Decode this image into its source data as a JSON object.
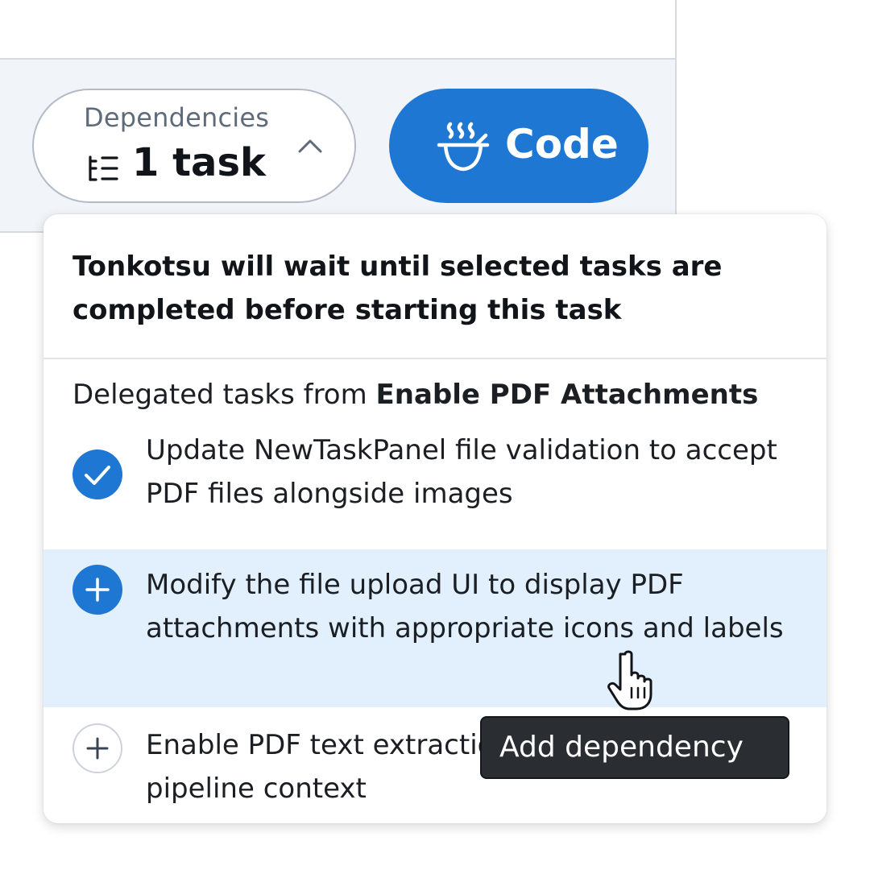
{
  "toolbar": {
    "dependencies": {
      "label": "Dependencies",
      "count": "1 task",
      "list_icon": "list-tree-icon",
      "chevron_icon": "chevron-up-icon"
    },
    "code_button": {
      "label": "Code",
      "icon": "ramen-bowl-icon",
      "color": "#1f77d4"
    }
  },
  "dropdown": {
    "header": "Tonkotsu will wait until selected tasks are completed before starting this task",
    "section_prefix": "Delegated tasks from ",
    "section_source": "Enable PDF Attachments",
    "tasks": [
      {
        "text": "Update NewTaskPanel file validation to accept PDF files alongside images",
        "status": "selected",
        "icon": "check-icon"
      },
      {
        "text": "Modify the file upload UI to display PDF attachments with appropriate icons and labels",
        "status": "hovered",
        "icon": "plus-icon"
      },
      {
        "text": "Enable PDF text extraction for task execution pipeline context",
        "status": "unselected",
        "icon": "plus-icon"
      }
    ]
  },
  "tooltip": {
    "text": "Add dependency"
  },
  "cursor": {
    "icon": "hand-pointer-icon"
  },
  "colors": {
    "accent": "#1f77d4",
    "highlight_row": "#e1f0fc",
    "toolbar_bg": "#f1f4f9",
    "tooltip_bg": "#2a2e33"
  }
}
